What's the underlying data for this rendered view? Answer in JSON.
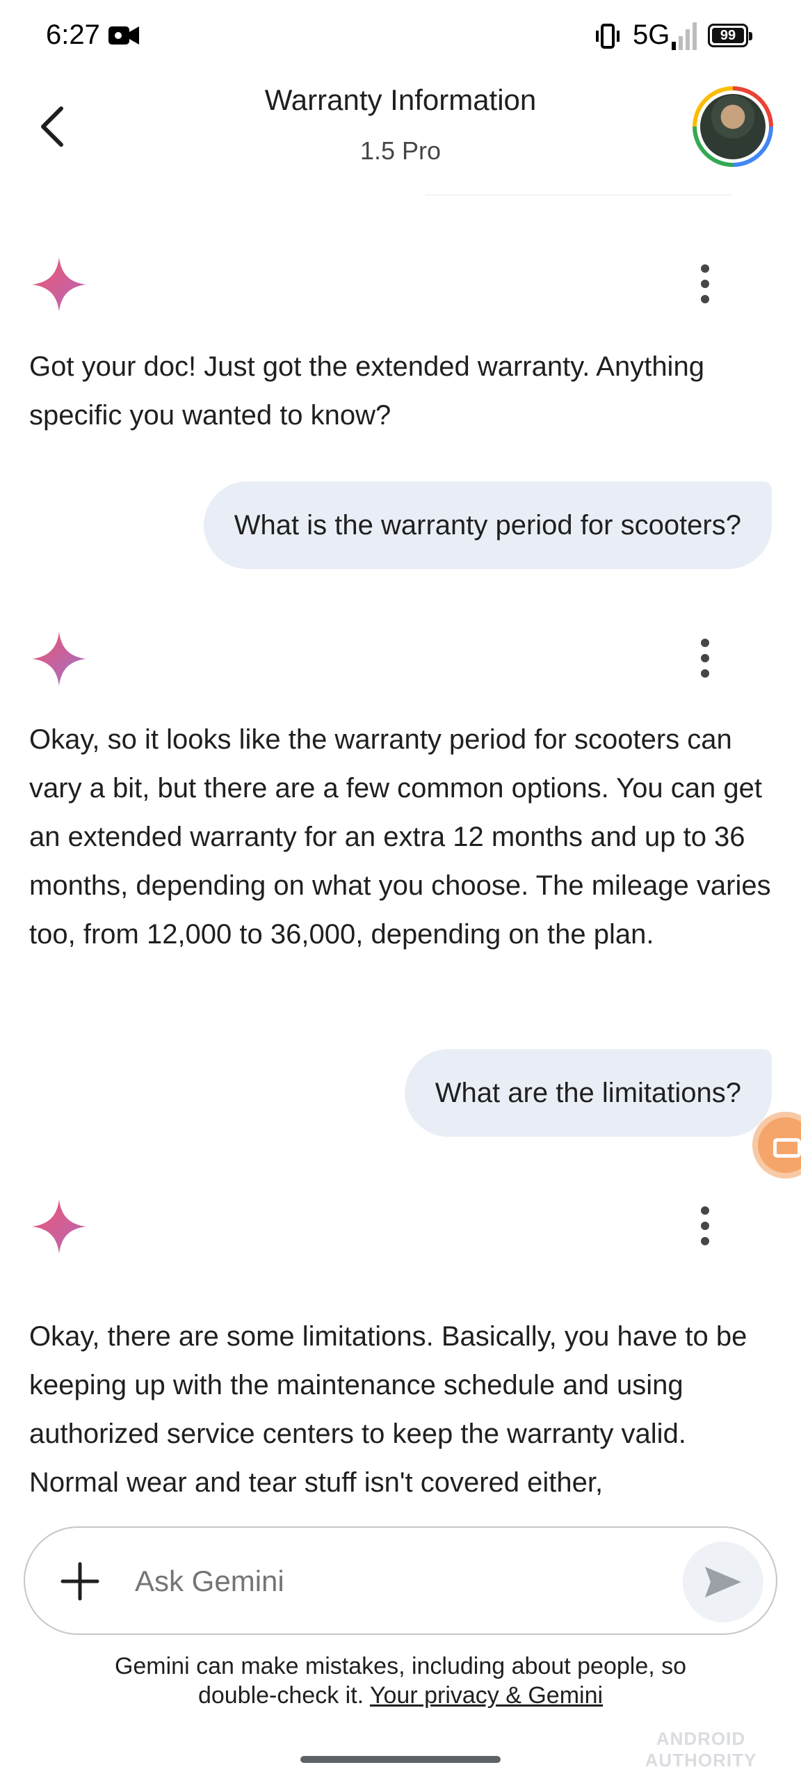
{
  "status_bar": {
    "time": "6:27",
    "network": "5G",
    "battery": "99"
  },
  "header": {
    "title": "Warranty Information",
    "subtitle": "1.5 Pro"
  },
  "messages": [
    {
      "role": "bot",
      "text": "Got your doc! Just got the extended warranty. Anything specific you wanted to know?"
    },
    {
      "role": "user",
      "text": "What is the warranty period for scooters?"
    },
    {
      "role": "bot",
      "text": "Okay, so it looks like the warranty period for scooters can vary a bit, but there are a few common options. You can get an extended warranty for an extra 12 months and up to 36 months, depending on what you choose. The mileage varies too, from 12,000 to 36,000, depending on the plan."
    },
    {
      "role": "user",
      "text": "What are the limitations?"
    },
    {
      "role": "bot",
      "text": "Okay, there are some limitations. Basically, you have to be keeping up with the maintenance schedule and using authorized service centers to keep the warranty valid. Normal wear and tear stuff isn't covered either,"
    }
  ],
  "input": {
    "placeholder": "Ask Gemini"
  },
  "disclaimer": {
    "line1": "Gemini can make mistakes, including about people, so",
    "line2_prefix": "double-check it.",
    "link": "Your privacy & Gemini"
  },
  "watermark": "ANDROID AUTHORITY",
  "colors": {
    "user_bubble": "#e9eef6",
    "sparkle_start": "#ef5370",
    "sparkle_end": "#9b72cb"
  },
  "icons": {
    "back": "back-arrow-icon",
    "sparkle": "gemini-sparkle-icon",
    "more": "more-vert-icon",
    "plus": "plus-icon",
    "send": "send-icon"
  }
}
